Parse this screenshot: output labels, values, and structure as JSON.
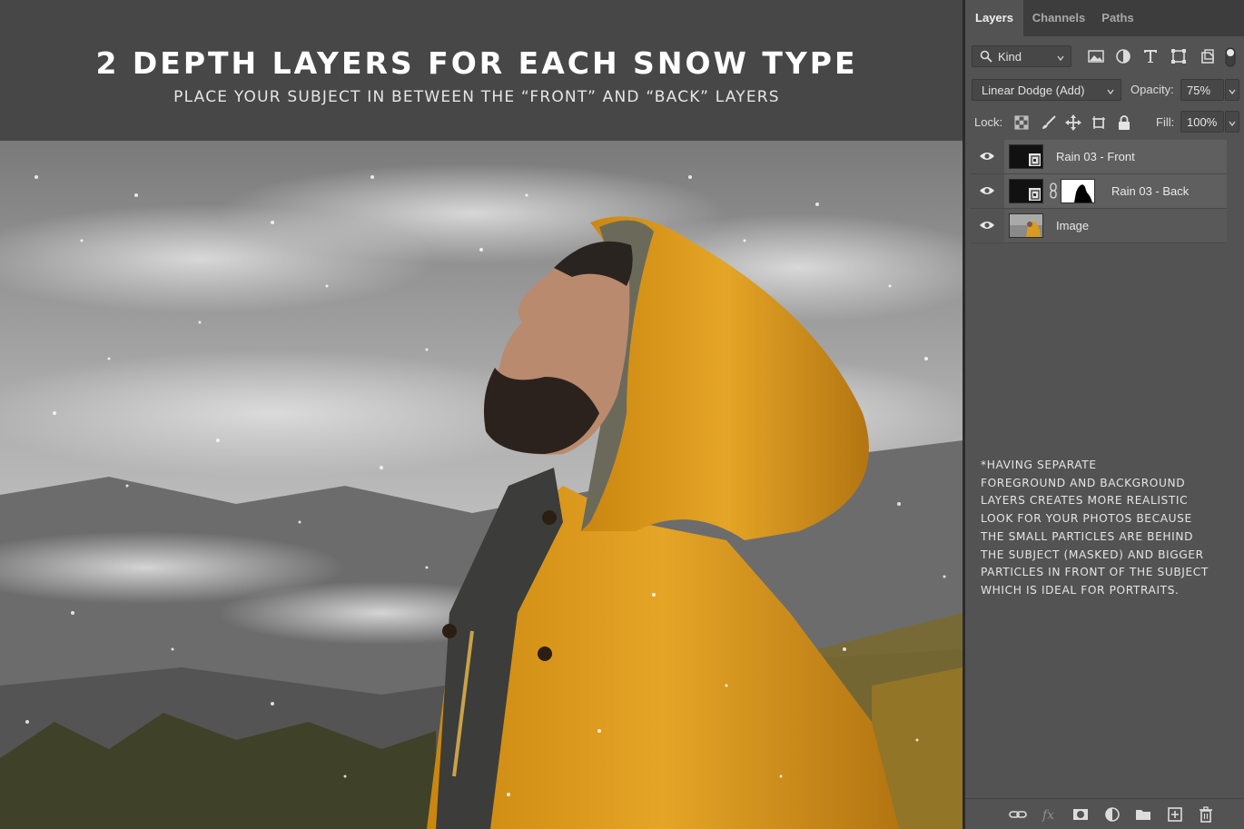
{
  "hero": {
    "title": "2 DEPTH LAYERS FOR EACH SNOW TYPE",
    "subtitle": "PLACE YOUR SUBJECT IN BETWEEN THE “FRONT” AND “BACK” LAYERS"
  },
  "panel": {
    "tabs": [
      {
        "label": "Layers",
        "active": true
      },
      {
        "label": "Channels",
        "active": false
      },
      {
        "label": "Paths",
        "active": false
      }
    ],
    "filter": {
      "kind_label": "Kind",
      "icons": [
        "image-filter-icon",
        "adjustment-filter-icon",
        "type-filter-icon",
        "shape-filter-icon",
        "smart-object-filter-icon"
      ]
    },
    "blend_mode": "Linear Dodge (Add)",
    "opacity_label": "Opacity:",
    "opacity_value": "75%",
    "lock_label": "Lock:",
    "fill_label": "Fill:",
    "fill_value": "100%",
    "layers": [
      {
        "name": "Rain 03 - Front",
        "visible": true,
        "mask": false,
        "selected": true
      },
      {
        "name": "Rain 03 - Back",
        "visible": true,
        "mask": true,
        "selected": true
      },
      {
        "name": "Image",
        "visible": true,
        "mask": false,
        "selected": false
      }
    ],
    "note": "*HAVING SEPARATE\nFOREGROUND AND BACKGROUND\nLAYERS CREATES MORE REALISTIC\nLOOK FOR YOUR PHOTOS BECAUSE\nTHE SMALL PARTICLES ARE BEHIND\nTHE SUBJECT (MASKED) AND BIGGER\nPARTICLES IN FRONT OF THE SUBJECT\nWHICH IS IDEAL FOR PORTRAITS.",
    "bottom_icons": [
      "link-layers-icon",
      "fx-icon",
      "add-mask-icon",
      "adjustment-layer-icon",
      "group-folder-icon",
      "new-layer-icon",
      "trash-icon"
    ]
  },
  "colors": {
    "jacket": "#e1a021",
    "panel_bg": "#535353",
    "header_bg": "#474747"
  }
}
